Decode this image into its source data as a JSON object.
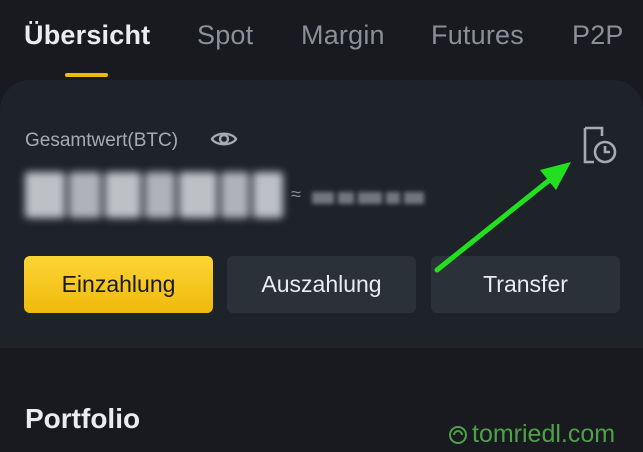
{
  "tabs": [
    {
      "label": "Übersicht",
      "active": true
    },
    {
      "label": "Spot",
      "active": false
    },
    {
      "label": "Margin",
      "active": false
    },
    {
      "label": "Futures",
      "active": false
    },
    {
      "label": "P2P",
      "active": false
    }
  ],
  "wallet": {
    "total_label": "Gesamtwert(BTC)",
    "approx_symbol": "≈",
    "balance_hidden": true
  },
  "actions": {
    "deposit": "Einzahlung",
    "withdraw": "Auszahlung",
    "transfer": "Transfer"
  },
  "portfolio": {
    "title": "Portfolio"
  },
  "watermark": {
    "text": "tomriedl.com"
  },
  "icons": {
    "eye": "eye-icon",
    "history": "transaction-history-icon",
    "annotation": "green-arrow-annotation"
  },
  "colors": {
    "background": "#181a20",
    "card": "#1e2329",
    "accent": "#f0b90b",
    "secondary_button": "#2b3139",
    "annotation_arrow": "#22e01f",
    "watermark": "#4ea14a"
  }
}
